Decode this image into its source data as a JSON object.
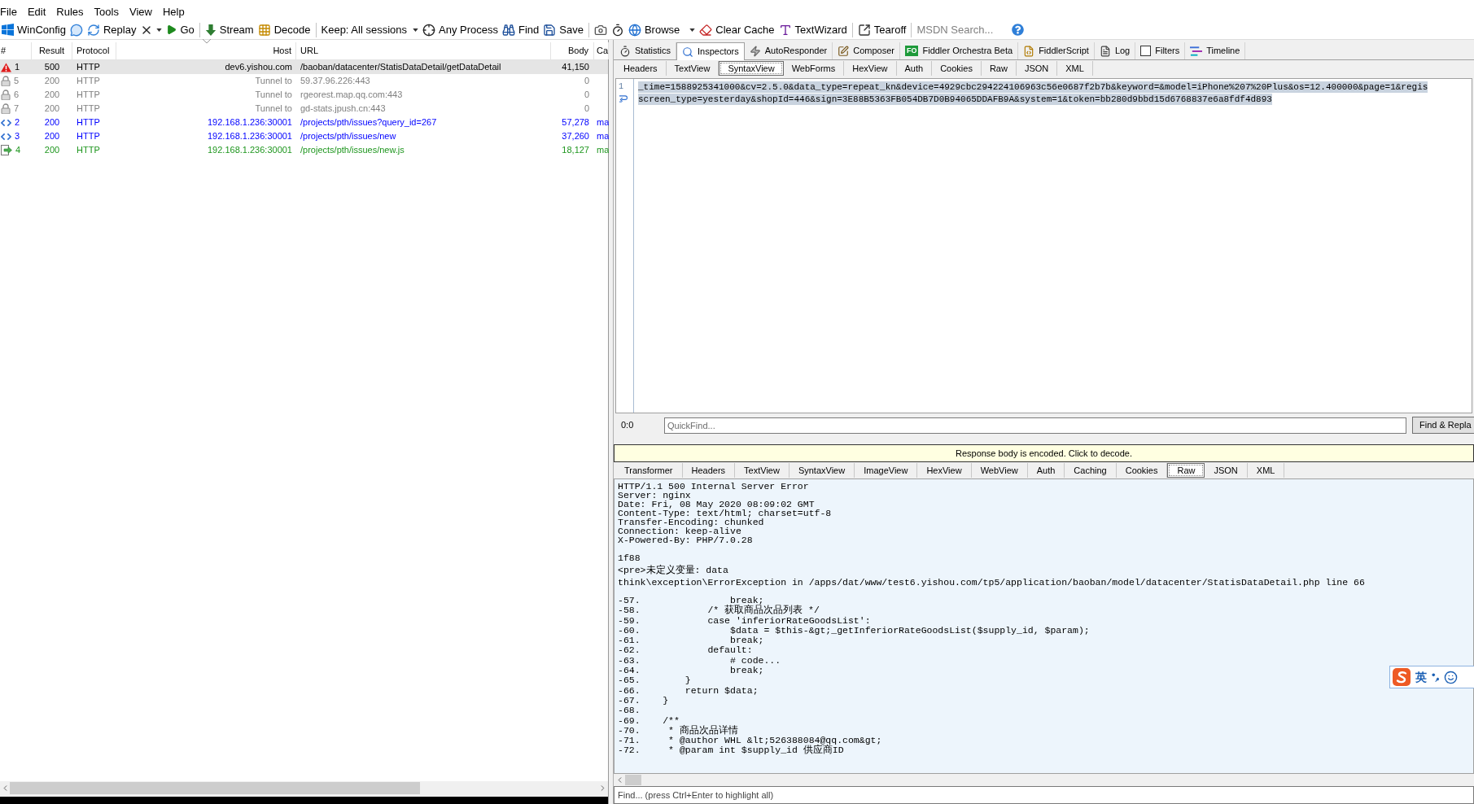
{
  "menu_bar": [
    {
      "label": "File"
    },
    {
      "label": "Edit"
    },
    {
      "label": "Rules"
    },
    {
      "label": "Tools"
    },
    {
      "label": "View"
    },
    {
      "label": "Help"
    }
  ],
  "toolbar": [
    {
      "kind": "button",
      "label": "WinConfig"
    },
    {
      "kind": "icon"
    },
    {
      "kind": "button",
      "label": "Replay"
    },
    {
      "kind": "split"
    },
    {
      "kind": "button",
      "label": "Go"
    },
    {
      "kind": "separator"
    },
    {
      "kind": "button",
      "label": "Stream"
    },
    {
      "kind": "button",
      "label": "Decode"
    },
    {
      "kind": "separator"
    },
    {
      "kind": "dropdown",
      "label": "Keep: All sessions"
    },
    {
      "kind": "button",
      "label": "Any Process"
    },
    {
      "kind": "button",
      "label": "Find"
    },
    {
      "kind": "button",
      "label": "Save"
    },
    {
      "kind": "separator"
    },
    {
      "kind": "icon"
    },
    {
      "kind": "icon"
    },
    {
      "kind": "menu_button",
      "label": "Browse"
    },
    {
      "kind": "button",
      "label": "Clear Cache"
    },
    {
      "kind": "button",
      "label": "TextWizard"
    },
    {
      "kind": "separator"
    },
    {
      "kind": "button",
      "label": "Tearoff"
    },
    {
      "kind": "separator"
    },
    {
      "kind": "search",
      "placeholder": "MSDN Search..."
    },
    {
      "kind": "icon"
    }
  ],
  "sessions": {
    "columns": [
      "#",
      "Result",
      "Protocol",
      "Host",
      "URL",
      "Body",
      "Ca"
    ],
    "rows": [
      {
        "kind": "error",
        "number": "1",
        "result": "500",
        "protocol": "HTTP",
        "host": "dev6.yishou.com",
        "url": "/baoban/datacenter/StatisDataDetail/getDataDetail",
        "body": "41,150",
        "selected": true,
        "color": "#000000"
      },
      {
        "kind": "tunnel",
        "number": "5",
        "result": "200",
        "protocol": "HTTP",
        "host": "Tunnel to",
        "url": "59.37.96.226:443",
        "body": "0",
        "selected": false,
        "color": "#808080"
      },
      {
        "kind": "tunnel",
        "number": "6",
        "result": "200",
        "protocol": "HTTP",
        "host": "Tunnel to",
        "url": "rgeorest.map.qq.com:443",
        "body": "0",
        "selected": false,
        "color": "#808080"
      },
      {
        "kind": "tunnel",
        "number": "7",
        "result": "200",
        "protocol": "HTTP",
        "host": "Tunnel to",
        "url": "gd-stats.jpush.cn:443",
        "body": "0",
        "selected": false,
        "color": "#808080"
      },
      {
        "kind": "html",
        "number": "2",
        "result": "200",
        "protocol": "HTTP",
        "host": "192.168.1.236:30001",
        "url": "/projects/pth/issues?query_id=267",
        "body": "57,278",
        "column_7": "ma",
        "selected": false,
        "color": "#0000ff"
      },
      {
        "kind": "html",
        "number": "3",
        "result": "200",
        "protocol": "HTTP",
        "host": "192.168.1.236:30001",
        "url": "/projects/pth/issues/new",
        "body": "37,260",
        "column_7": "ma",
        "selected": false,
        "color": "#0000ff"
      },
      {
        "kind": "script",
        "number": "4",
        "result": "200",
        "protocol": "HTTP",
        "host": "192.168.1.236:30001",
        "url": "/projects/pth/issues/new.js",
        "body": "18,127",
        "column_7": "ma",
        "selected": false,
        "color": "#1e961e"
      }
    ]
  },
  "inspector_tabs": [
    {
      "label": "Statistics",
      "selected": false
    },
    {
      "label": "Inspectors",
      "selected": true
    },
    {
      "label": "AutoResponder",
      "selected": false
    },
    {
      "label": "Composer",
      "selected": false
    },
    {
      "label": "Fiddler Orchestra Beta",
      "selected": false,
      "badge": "FO"
    },
    {
      "label": "FiddlerScript",
      "selected": false
    },
    {
      "label": "Log",
      "selected": false
    },
    {
      "label": "Filters",
      "selected": false,
      "checked": false
    },
    {
      "label": "Timeline",
      "selected": false
    }
  ],
  "request": {
    "tabs": [
      {
        "label": "Headers",
        "selected": false
      },
      {
        "label": "TextView",
        "selected": false
      },
      {
        "label": "SyntaxView",
        "selected": true
      },
      {
        "label": "WebForms",
        "selected": false
      },
      {
        "label": "HexView",
        "selected": false
      },
      {
        "label": "Auth",
        "selected": false
      },
      {
        "label": "Cookies",
        "selected": false
      },
      {
        "label": "Raw",
        "selected": false
      },
      {
        "label": "JSON",
        "selected": false
      },
      {
        "label": "XML",
        "selected": false
      }
    ],
    "selected": true,
    "lines": [
      {
        "kind": "numbered",
        "number": "1",
        "text": "_time=1588925341000&cv=2.5.0&data_type=repeat_kn&device=4929cbc294224106963c56e0687f2b7b&keyword=&model=iPhone%207%20Plus&os=12.400000&page=1&regis"
      },
      {
        "kind": "wrap",
        "text": "screen_type=yesterday&shopId=446&sign=3E88B5363FB054DB7D0B94065DDAFB9A&system=1&token=bb280d9bbd15d6768837e6a8fdf4d893"
      }
    ]
  },
  "quickfind": {
    "position": "0:0",
    "placeholder": "QuickFind...",
    "button": "Find & Repla"
  },
  "notice": "Response body is encoded. Click to decode.",
  "response": {
    "tabs": [
      {
        "label": "Transformer",
        "selected": false
      },
      {
        "label": "Headers",
        "selected": false
      },
      {
        "label": "TextView",
        "selected": false
      },
      {
        "label": "SyntaxView",
        "selected": false
      },
      {
        "label": "ImageView",
        "selected": false
      },
      {
        "label": "HexView",
        "selected": false
      },
      {
        "label": "WebView",
        "selected": false
      },
      {
        "label": "Auth",
        "selected": false
      },
      {
        "label": "Caching",
        "selected": false
      },
      {
        "label": "Cookies",
        "selected": false
      },
      {
        "label": "Raw",
        "selected": true
      },
      {
        "label": "JSON",
        "selected": false
      },
      {
        "label": "XML",
        "selected": false
      }
    ],
    "blocks": [
      [
        "HTTP/1.1 500 Internal Server Error",
        "Server: nginx",
        "Date: Fri, 08 May 2020 08:09:02 GMT",
        "Content-Type: text/html; charset=utf-8",
        "Transfer-Encoding: chunked",
        "Connection: keep-alive",
        "X-Powered-By: PHP/7.0.28"
      ],
      [
        "1f88",
        "<pre>未定义变量: data",
        "think\\exception\\ErrorException in /apps/dat/www/test6.yishou.com/tp5/application/baoban/model/datacenter/StatisDataDetail.php line 66"
      ],
      [
        "-57.                break;",
        "-58.            /* 获取商品次品列表 */",
        "-59.            case 'inferiorRateGoodsList':",
        "-60.                $data = $this-&gt;_getInferiorRateGoodsList($supply_id, $param);",
        "-61.                break;",
        "-62.            default:",
        "-63.                # code...",
        "-64.                break;",
        "-65.        }",
        "-66.        return $data;",
        "-67.    }",
        "-68.",
        "-69.    /**",
        "-70.     * 商品次品详情",
        "-71.     * @author WHL &lt;526388084@qq.com&gt;",
        "-72.     * @param int $supply_id 供应商ID"
      ]
    ]
  },
  "find_field": {
    "placeholder": "Find... (press Ctrl+Enter to highlight all)"
  },
  "ime_toolbar": {
    "mode": "英"
  }
}
